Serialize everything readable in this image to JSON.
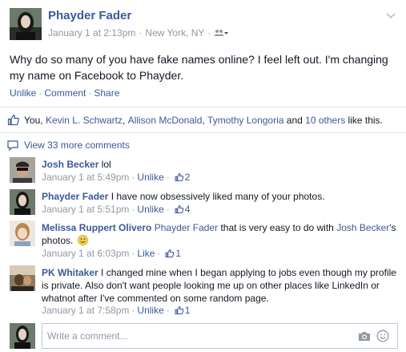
{
  "post": {
    "author": "Phayder Fader",
    "timestamp": "January 1 at 2:13pm",
    "location": "New York, NY",
    "audience_icon": "friends-icon",
    "text": "Why do so many of you have fake names online? I feel left out. I'm changing my name on Facebook to Phayder.",
    "actions": {
      "unlike": "Unlike",
      "comment": "Comment",
      "share": "Share"
    }
  },
  "likes": {
    "you": "You,",
    "people": [
      "Kevin L. Schwartz",
      "Allison McDonald",
      "Tymothy Longoria"
    ],
    "and": "and",
    "others": "10 others",
    "suffix": "like this."
  },
  "view_more": "View 33 more comments",
  "comments": [
    {
      "name": "Josh Becker",
      "text": "lol",
      "time": "January 1 at 5:49pm",
      "action": "Unlike",
      "likes": "2"
    },
    {
      "name": "Phayder Fader",
      "text": "I have now obsessively liked many of your photos.",
      "time": "January 1 at 5:51pm",
      "action": "Unlike",
      "likes": "4"
    },
    {
      "name": "Melissa Ruppert Olivero",
      "mention": "Phayder Fader",
      "text_a": "that is very easy to do with",
      "mention2": "Josh Becker",
      "text_b": "'s photos.",
      "time": "January 1 at 6:03pm",
      "action": "Like",
      "likes": "1"
    },
    {
      "name": "PK Whitaker",
      "text": "I changed mine when I began applying to jobs even though my profile is private. Also don't want people looking me up on other places like LinkedIn or whatnot after I've commented on some random page.",
      "time": "January 1 at 7:58pm",
      "action": "Unlike",
      "likes": "1"
    }
  ],
  "composer": {
    "placeholder": "Write a comment..."
  },
  "colors": {
    "link": "#3b5998",
    "meta": "#9197a3",
    "text": "#141823",
    "divider": "#e1e2e3"
  }
}
